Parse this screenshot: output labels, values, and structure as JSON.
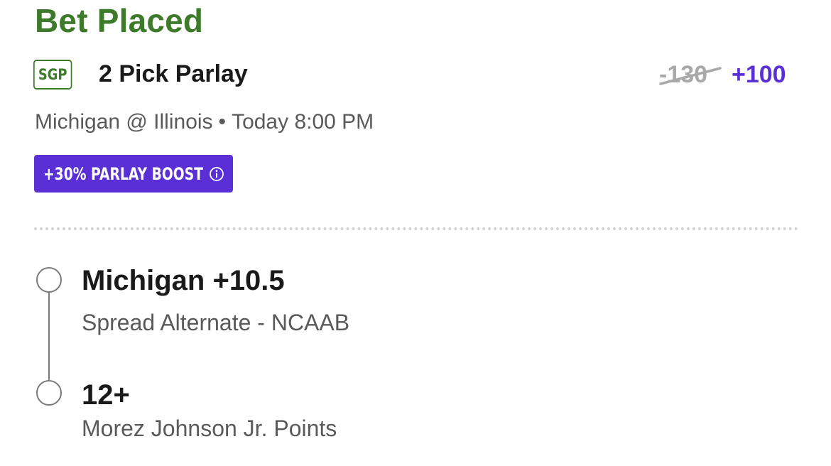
{
  "header": {
    "title": "Bet Placed"
  },
  "bet": {
    "badge": "SGP",
    "title": "2 Pick Parlay",
    "odds_original": "-130",
    "odds_boosted": "+100",
    "game": "Michigan @ Illinois",
    "separator": "•",
    "time": "Today 8:00 PM",
    "boost_label": "+30% PARLAY BOOST"
  },
  "legs": [
    {
      "selection": "Michigan +10.5",
      "market": "Spread Alternate - NCAAB"
    },
    {
      "selection": "12+",
      "market": "Morez Johnson Jr. Points"
    }
  ],
  "colors": {
    "title_green": "#3d7a2a",
    "boost_purple": "#5b2fd6",
    "muted_gray": "#a9a9a9"
  },
  "icons": {
    "boost_info": "info-icon"
  }
}
